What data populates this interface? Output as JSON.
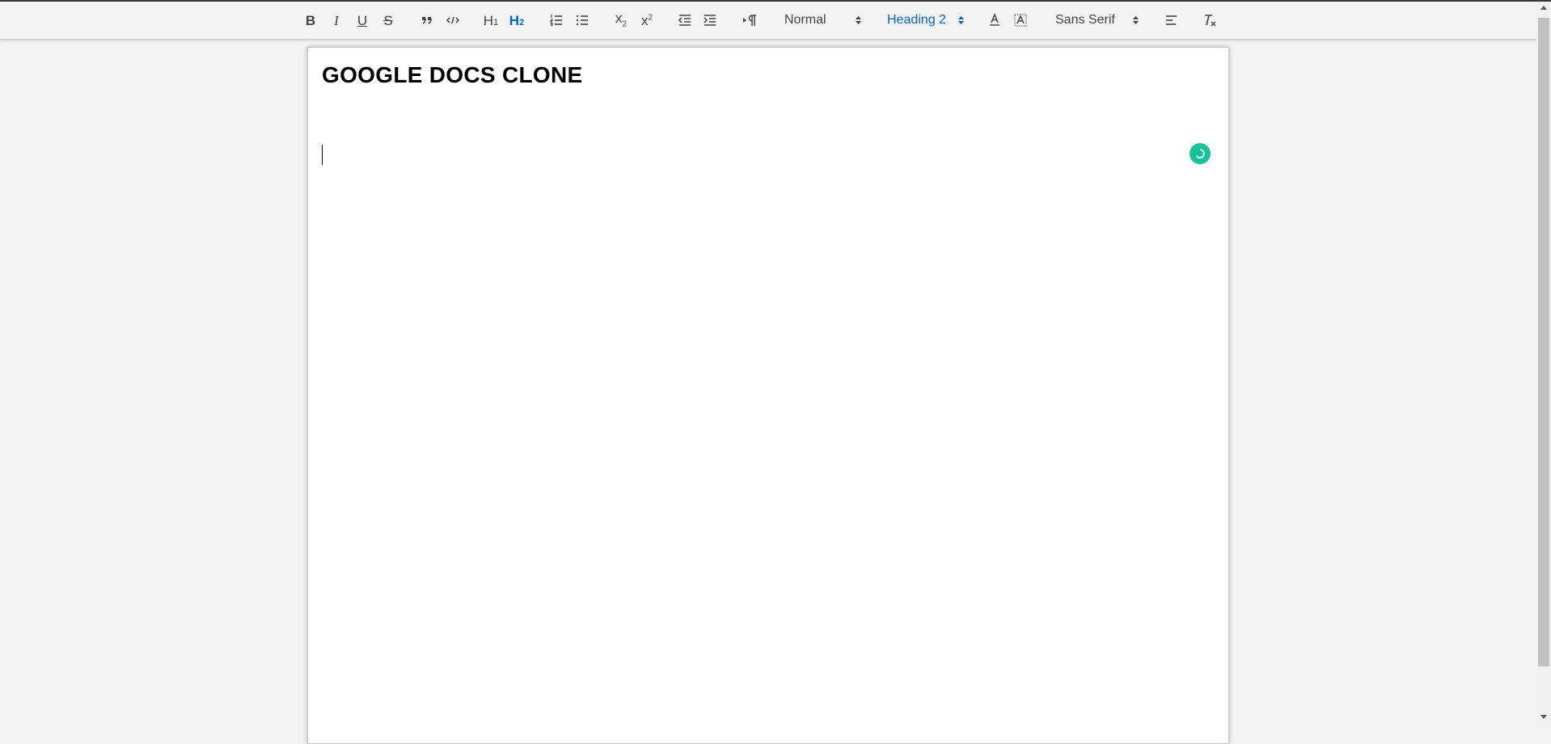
{
  "toolbar": {
    "bold_icon": "B",
    "italic_icon": "I",
    "underline_icon": "U",
    "strike_icon": "S",
    "h1_icon": "H",
    "h1_sub": "1",
    "h2_icon": "H",
    "h2_sub": "2",
    "subscript_icon": "x",
    "subscript_sub": "2",
    "superscript_icon": "x",
    "superscript_sup": "2",
    "size_picker": "Normal",
    "header_picker": "Heading 2",
    "font_picker": "Sans Serif",
    "active_color": "#0066cc",
    "icons": [
      "bold-icon",
      "italic-icon",
      "underline-icon",
      "strike-icon",
      "blockquote-icon",
      "code-block-icon",
      "h1-icon",
      "h2-icon",
      "ordered-list-icon",
      "bullet-list-icon",
      "subscript-icon",
      "superscript-icon",
      "outdent-icon",
      "indent-icon",
      "text-direction-icon",
      "font-color-icon",
      "background-color-icon",
      "align-left-icon",
      "clean-format-icon"
    ]
  },
  "document": {
    "title": "GOOGLE DOCS CLONE"
  },
  "colors": {
    "grammarly_badge": "#15c39a",
    "background": "#f3f3f3"
  }
}
